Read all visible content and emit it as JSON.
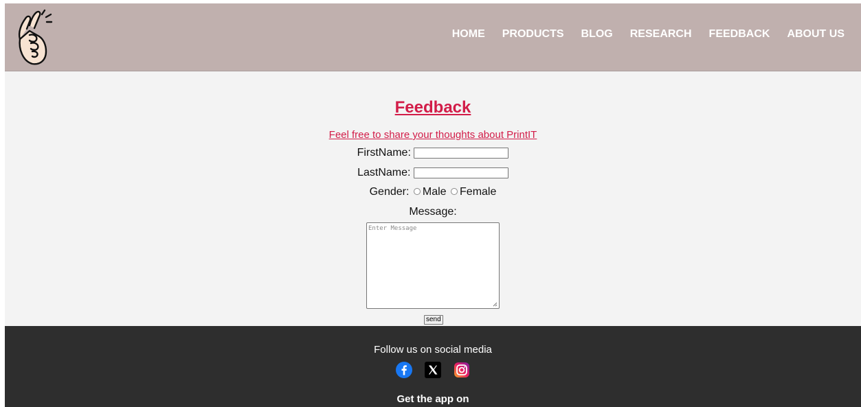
{
  "nav": {
    "items": [
      "HOME",
      "PRODUCTS",
      "BLOG",
      "RESEARCH",
      "FEEDBACK",
      "ABOUT US"
    ]
  },
  "form": {
    "title": "Feedback",
    "subtitle": "Feel free to share your thoughts about PrintIT",
    "first_name_label": "FirstName:",
    "first_name_value": "",
    "last_name_label": "LastName:",
    "last_name_value": "",
    "gender_label": "Gender:",
    "gender_male": "Male",
    "gender_female": "Female",
    "message_label": "Message:",
    "message_placeholder": "Enter Message",
    "send_label": "send"
  },
  "footer": {
    "follow_text": "Follow us on social media",
    "get_app_text": "Get the app on",
    "social_icons": [
      "facebook-icon",
      "x-icon",
      "instagram-icon"
    ]
  },
  "colors": {
    "header_bg": "#c0b0ae",
    "accent": "#d21c48",
    "footer_bg": "#2e2e2e",
    "page_bg": "#f3f3f3"
  }
}
